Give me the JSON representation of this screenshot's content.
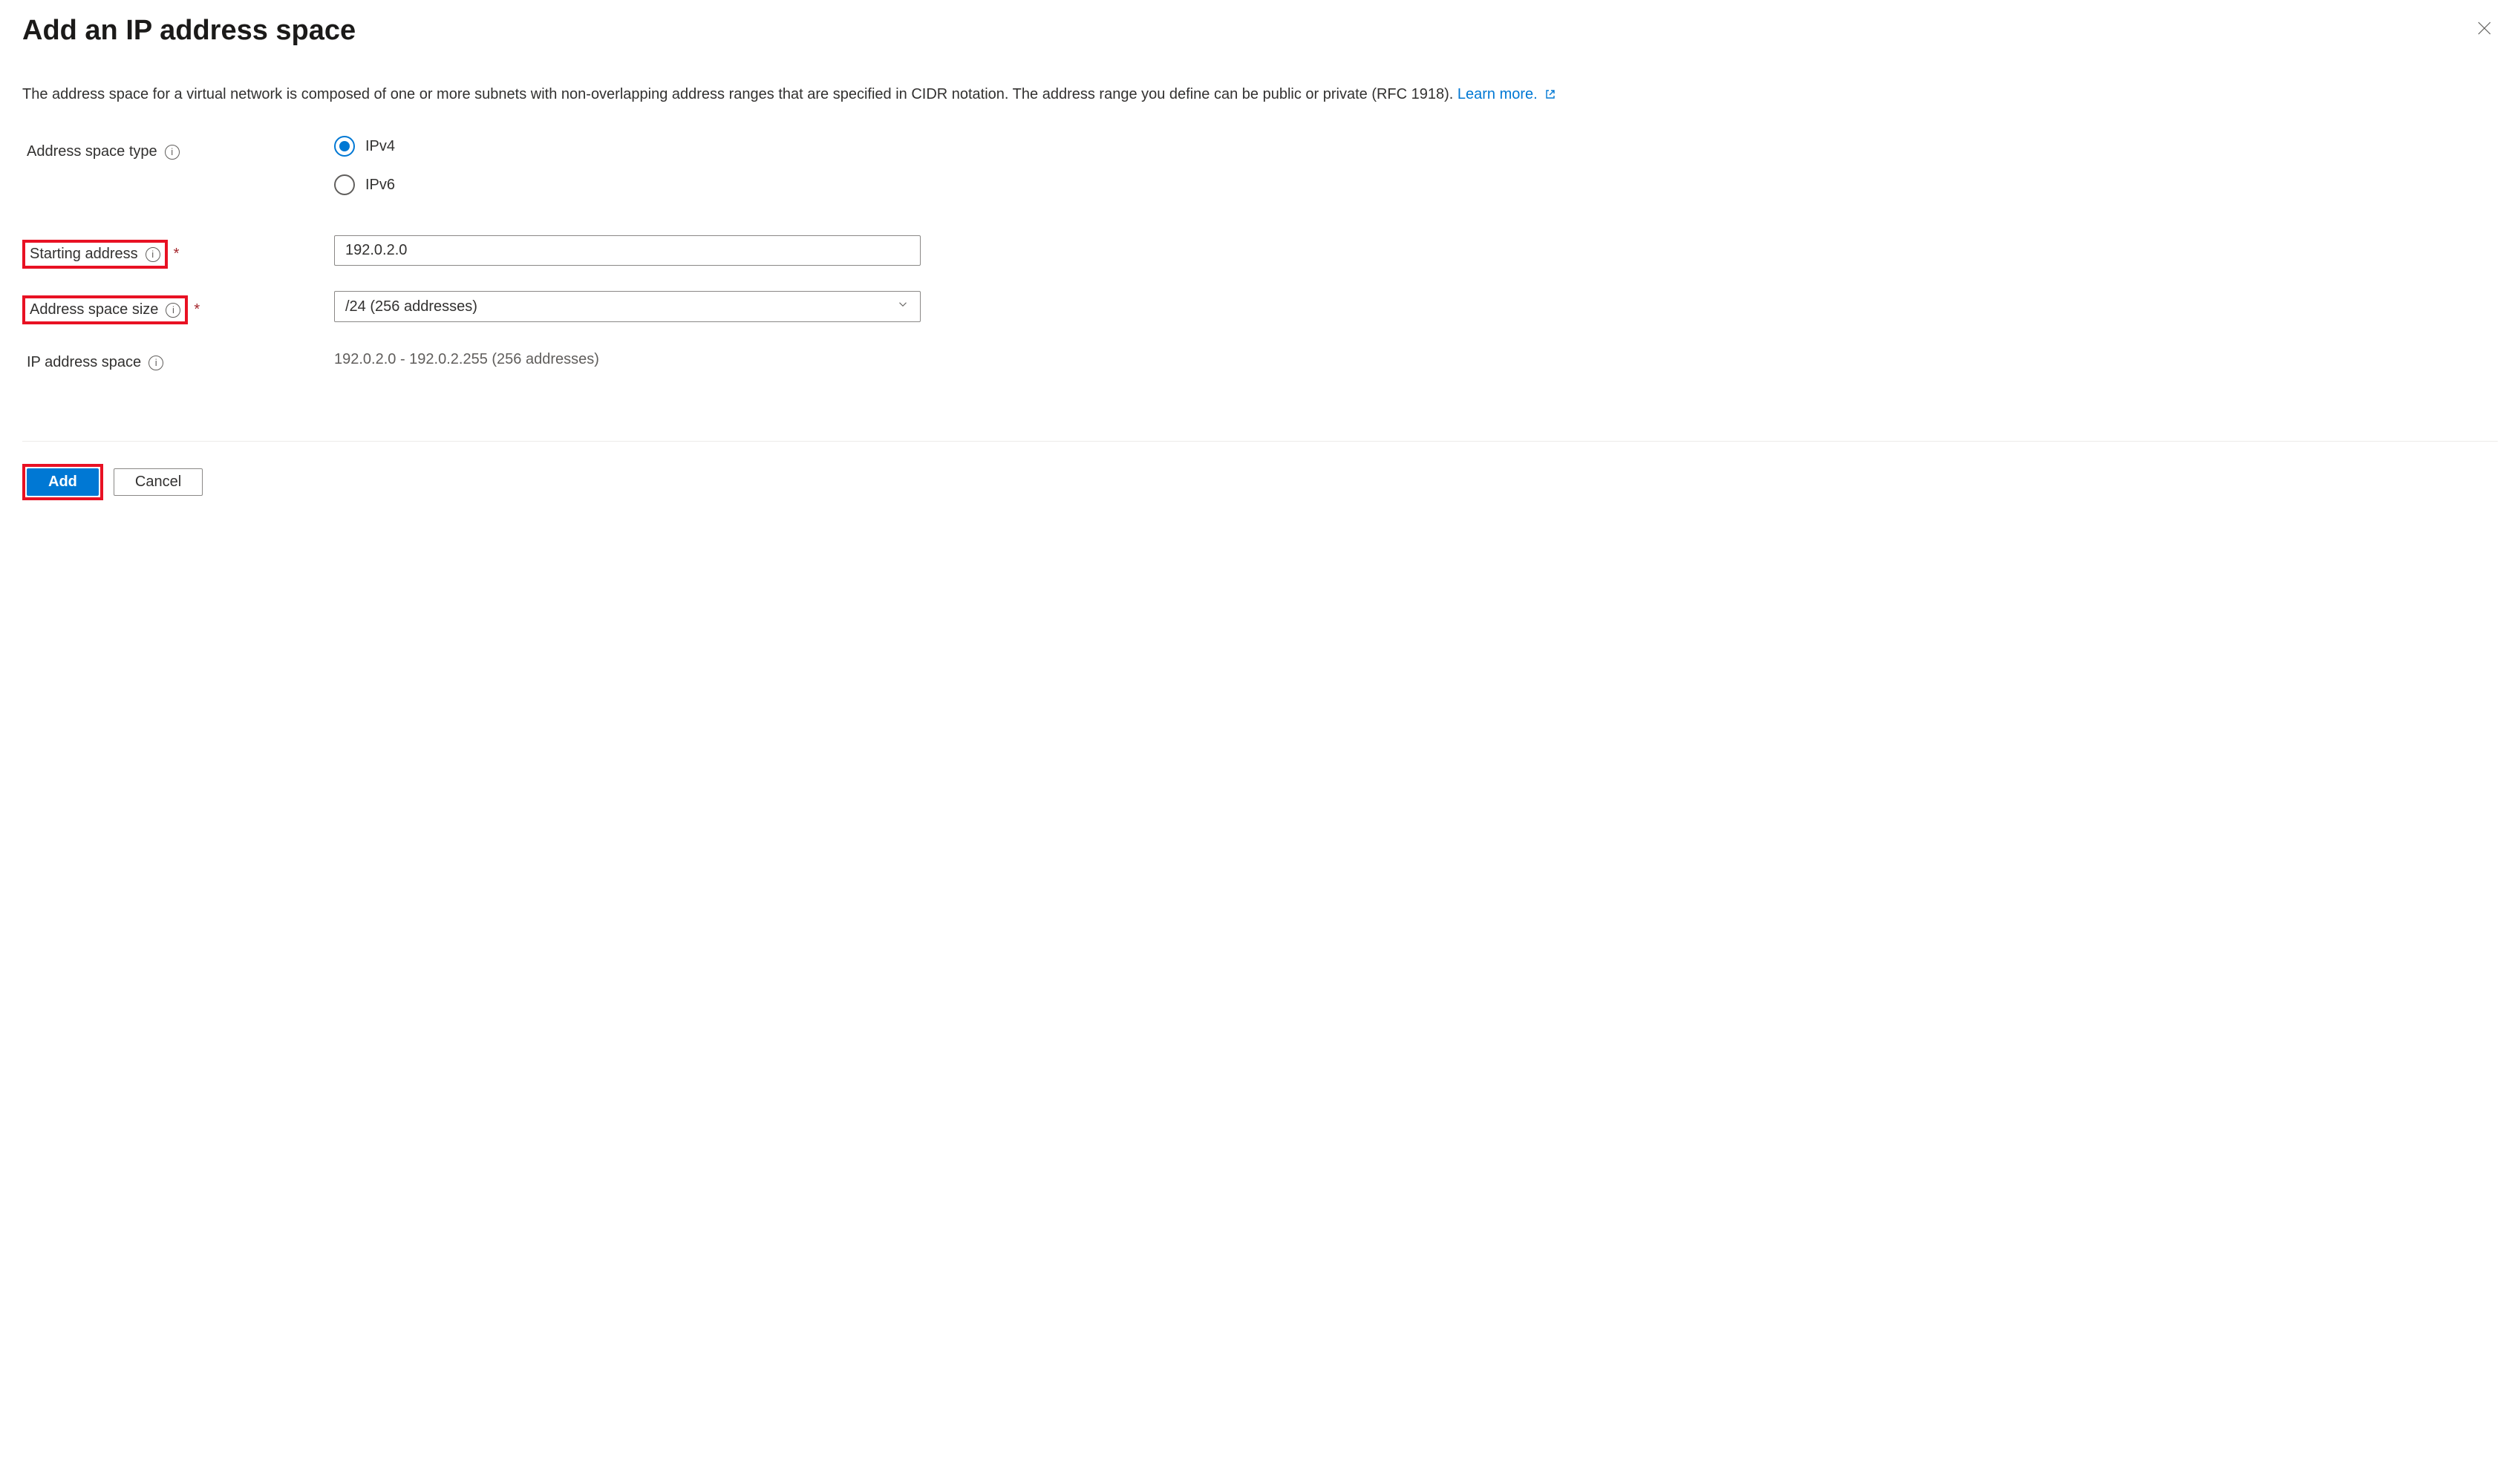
{
  "header": {
    "title": "Add an IP address space"
  },
  "description": {
    "text": "The address space for a virtual network is composed of one or more subnets with non-overlapping address ranges that are specified in CIDR notation. The address range you define can be public or private (RFC 1918).",
    "link_label": "Learn more."
  },
  "fields": {
    "address_space_type": {
      "label": "Address space type",
      "options": {
        "ipv4": "IPv4",
        "ipv6": "IPv6"
      },
      "selected": "ipv4"
    },
    "starting_address": {
      "label": "Starting address",
      "value": "192.0.2.0"
    },
    "address_space_size": {
      "label": "Address space size",
      "value": "/24 (256 addresses)"
    },
    "ip_address_space": {
      "label": "IP address space",
      "value": "192.0.2.0 - 192.0.2.255 (256 addresses)"
    }
  },
  "footer": {
    "add_label": "Add",
    "cancel_label": "Cancel"
  }
}
